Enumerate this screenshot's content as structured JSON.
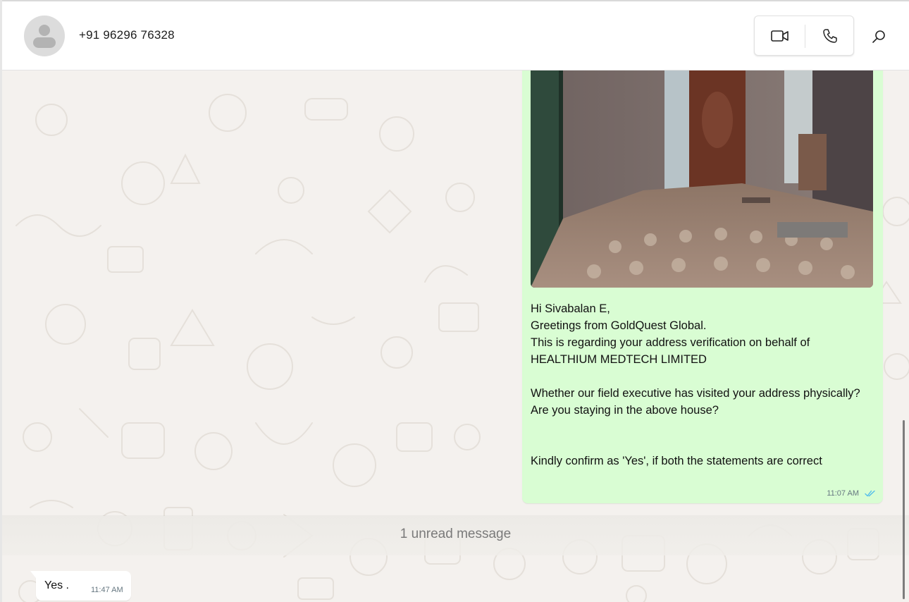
{
  "header": {
    "contact_name": "+91 96296 76328",
    "icons": {
      "avatar": "default-avatar",
      "video": "video-camera-icon",
      "voice": "phone-icon",
      "search": "search-icon"
    }
  },
  "chat": {
    "outgoing_message": {
      "has_photo": true,
      "text": "Hi Sivabalan E,\nGreetings from GoldQuest Global.\nThis is regarding your address verification on behalf of\nHEALTHIUM MEDTECH LIMITED\n\nWhether our field executive has visited your address physically?\nAre you staying in the above house?\n\n\nKindly confirm as 'Yes', if both the statements are correct",
      "time": "11:07 AM",
      "status": "read"
    },
    "unread_divider": "1 unread message",
    "incoming_message": {
      "text": "Yes .",
      "time": "11:47 AM"
    }
  },
  "colors": {
    "outgoing_bubble": "#d9fdd3",
    "incoming_bubble": "#ffffff",
    "chat_background": "#f4f1ee",
    "read_ticks": "#53bdeb"
  }
}
